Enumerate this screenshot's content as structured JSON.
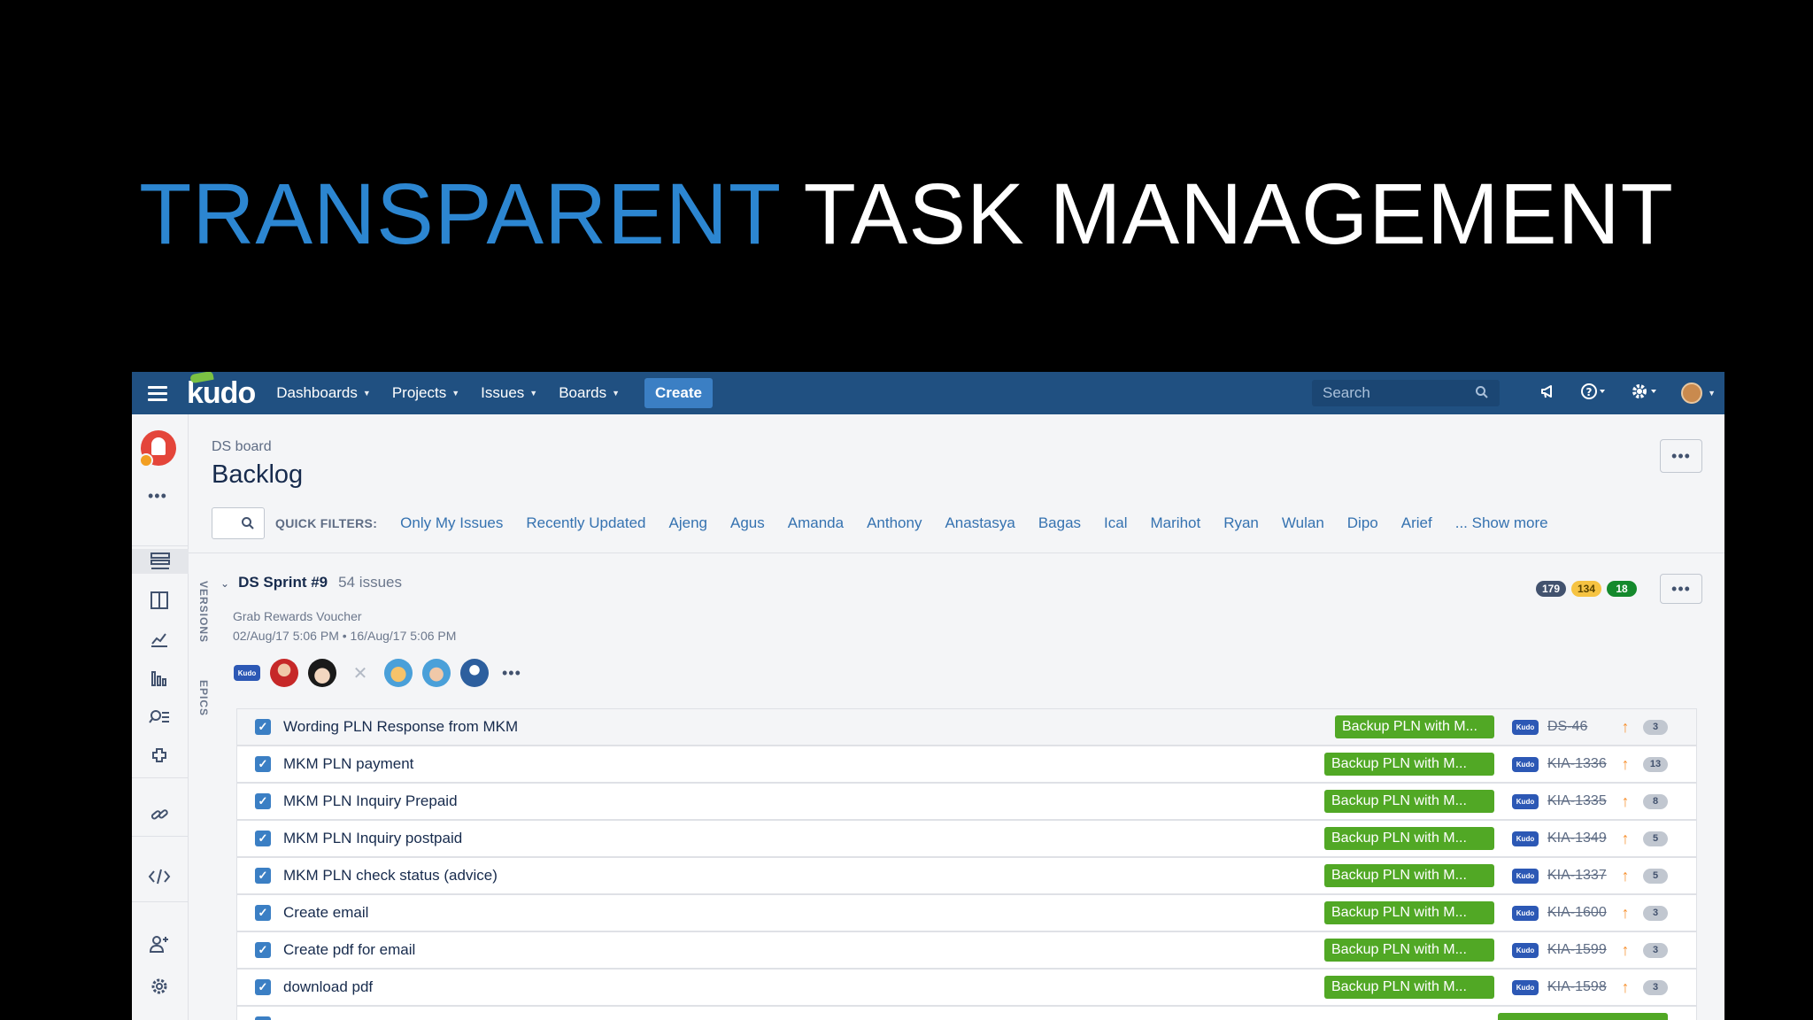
{
  "slide": {
    "title_accent": "TRANSPARENT",
    "title_rest": "TASK MANAGEMENT"
  },
  "nav": {
    "logo": "kudo",
    "items": [
      {
        "label": "Dashboards"
      },
      {
        "label": "Projects"
      },
      {
        "label": "Issues"
      },
      {
        "label": "Boards"
      }
    ],
    "create_label": "Create",
    "search_placeholder": "Search"
  },
  "header": {
    "breadcrumb": "DS board",
    "title": "Backlog"
  },
  "filters": {
    "label": "QUICK FILTERS:",
    "items": [
      "Only My Issues",
      "Recently Updated",
      "Ajeng",
      "Agus",
      "Amanda",
      "Anthony",
      "Anastasya",
      "Bagas",
      "Ical",
      "Marihot",
      "Ryan",
      "Wulan",
      "Dipo",
      "Arief"
    ],
    "show_more": "... Show more"
  },
  "side_tabs": {
    "versions": "VERSIONS",
    "epics": "EPICS"
  },
  "sprint": {
    "name": "DS Sprint #9",
    "count": "54 issues",
    "goal": "Grab Rewards Voucher",
    "dates": "02/Aug/17 5:06 PM • 16/Aug/17 5:06 PM",
    "pills": [
      {
        "value": "179",
        "bg": "#42526e",
        "fg": "#ffffff"
      },
      {
        "value": "134",
        "bg": "#f6c342",
        "fg": "#594300"
      },
      {
        "value": "18",
        "bg": "#14892c",
        "fg": "#ffffff"
      }
    ],
    "project_tag": "Kudo"
  },
  "issues": [
    {
      "summary": "Wording PLN Response from MKM",
      "epic": "Backup PLN with M...",
      "key": "DS-46",
      "estimate": "3"
    },
    {
      "summary": "MKM PLN payment",
      "epic": "Backup PLN with M...",
      "key": "KIA-1336",
      "estimate": "13"
    },
    {
      "summary": "MKM PLN Inquiry Prepaid",
      "epic": "Backup PLN with M...",
      "key": "KIA-1335",
      "estimate": "8"
    },
    {
      "summary": "MKM PLN Inquiry postpaid",
      "epic": "Backup PLN with M...",
      "key": "KIA-1349",
      "estimate": "5"
    },
    {
      "summary": "MKM PLN check status (advice)",
      "epic": "Backup PLN with M...",
      "key": "KIA-1337",
      "estimate": "5"
    },
    {
      "summary": "Create email",
      "epic": "Backup PLN with M...",
      "key": "KIA-1600",
      "estimate": "3"
    },
    {
      "summary": "Create pdf for email",
      "epic": "Backup PLN with M...",
      "key": "KIA-1599",
      "estimate": "3"
    },
    {
      "summary": "download pdf",
      "epic": "Backup PLN with M...",
      "key": "KIA-1598",
      "estimate": "3"
    }
  ],
  "colors": {
    "nav": "#205081",
    "accent": "#2c86d1",
    "epic": "#51a825",
    "priority": "#f79232"
  }
}
